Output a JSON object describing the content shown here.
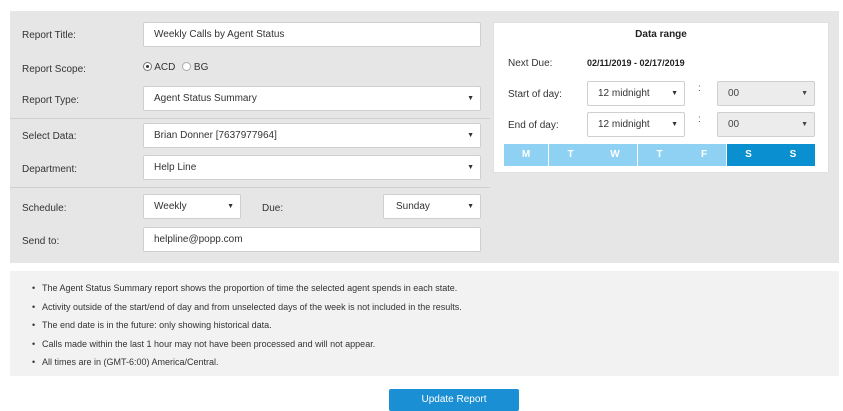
{
  "form": {
    "report_title_label": "Report Title:",
    "report_title_value": "Weekly Calls by Agent Status",
    "report_scope_label": "Report Scope:",
    "scope_acd": "ACD",
    "scope_bg": "BG",
    "report_type_label": "Report Type:",
    "report_type_value": "Agent Status Summary",
    "select_data_label": "Select Data:",
    "select_data_value": "Brian Donner [7637977964]",
    "department_label": "Department:",
    "department_value": "Help Line",
    "schedule_label": "Schedule:",
    "schedule_value": "Weekly",
    "due_label": "Due:",
    "due_value": "Sunday",
    "send_to_label": "Send to:",
    "send_to_value": "helpline@popp.com"
  },
  "range": {
    "title": "Data range",
    "next_due_label": "Next Due:",
    "next_due_value": "02/11/2019 - 02/17/2019",
    "start_label": "Start of day:",
    "start_value": "12 midnight",
    "start_min": "00",
    "end_label": "End of day:",
    "end_value": "12 midnight",
    "end_min": "00",
    "colon": ":",
    "days": [
      {
        "label": "M",
        "active": false
      },
      {
        "label": "T",
        "active": false
      },
      {
        "label": "W",
        "active": false
      },
      {
        "label": "T",
        "active": false
      },
      {
        "label": "F",
        "active": false
      },
      {
        "label": "S",
        "active": true
      },
      {
        "label": "S",
        "active": true
      }
    ]
  },
  "notes": [
    "The Agent Status Summary report shows the proportion of time the selected agent spends in each state.",
    "Activity outside of the start/end of day and from unselected days of the week is not included in the results.",
    "The end date is in the future: only showing historical data.",
    "Calls made within the last 1 hour may not have been processed and will not appear.",
    "All times are in (GMT-6:00) America/Central."
  ],
  "update_button": "Update Report",
  "icons": {
    "caret": "▼"
  },
  "colors": {
    "accent": "#0a8fd0",
    "day_inactive": "#8ed1f2",
    "panel": "#e6e6e6"
  }
}
